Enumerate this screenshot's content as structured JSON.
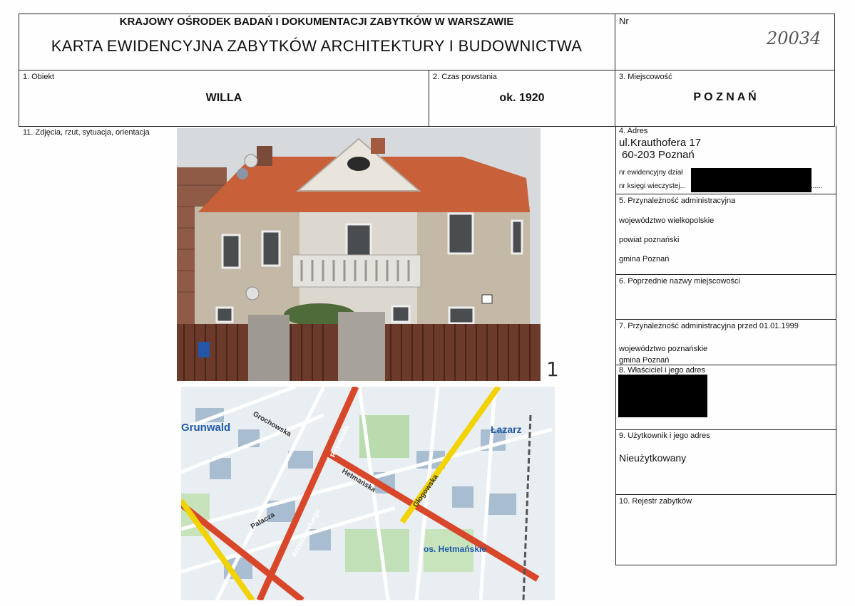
{
  "header": {
    "institution": "KRAJOWY OŚRODEK BADAŃ I DOKUMENTACJI ZABYTKÓW W WARSZAWIE",
    "title": "KARTA EWIDENCYJNA ZABYTKÓW ARCHITEKTURY I BUDOWNICTWA",
    "nr_label": "Nr",
    "nr_value": "20034"
  },
  "fields": {
    "obiekt": {
      "label": "1. Obiekt",
      "value": "WILLA"
    },
    "czas": {
      "label": "2. Czas powstania",
      "value": "ok. 1920"
    },
    "miejscowosc": {
      "label": "3. Miejscowość",
      "value": "P O Z N A Ń"
    },
    "photos": {
      "label": "11.  Zdjęcia, rzut, sytuacja, orientacja",
      "photo_number": "1"
    },
    "adres": {
      "label": "4. Adres",
      "line1": "ul.Krauthofera 17",
      "line2": "60-203 Poznań",
      "dzialka_label": "nr ewidencyjny dział",
      "ksiega_label": "nr księgi wieczystej...",
      "ksiega_dots": "......"
    },
    "przynaleznosc": {
      "label": "5. Przynależność administracyjna",
      "wojewodztwo": "województwo  wielkopolskie",
      "powiat": "powiat poznański",
      "gmina": "gmina  Poznań"
    },
    "poprzednie": {
      "label": "6. Poprzednie nazwy miejscowości"
    },
    "przed1999": {
      "label": "7. Przynależność administracyjna przed 01.01.1999",
      "wojewodztwo": "województwo poznańskie",
      "gmina": "gmina Poznań"
    },
    "wlasciciel": {
      "label": "8. Właściciel i jego adres"
    },
    "uzytkownik": {
      "label": "9. Użytkownik i jego adres",
      "value": "Nieużytkowany"
    },
    "rejestr": {
      "label": "10. Rejestr zabytków"
    }
  },
  "map": {
    "districts": [
      "Grunwald",
      "Łazarz",
      "os. Hetmańskie"
    ],
    "streets": [
      "Grochowska",
      "Hetmańska",
      "Głogowska",
      "Arciszewskiego",
      "Reymonta",
      "Palacza"
    ]
  },
  "colors": {
    "roof": "#c8603a",
    "facade": "#c4b8a6",
    "fence": "#6b3a2a",
    "map_bg": "#e8eef2",
    "road_main": "#d9472b",
    "road_yellow": "#f2d200"
  }
}
